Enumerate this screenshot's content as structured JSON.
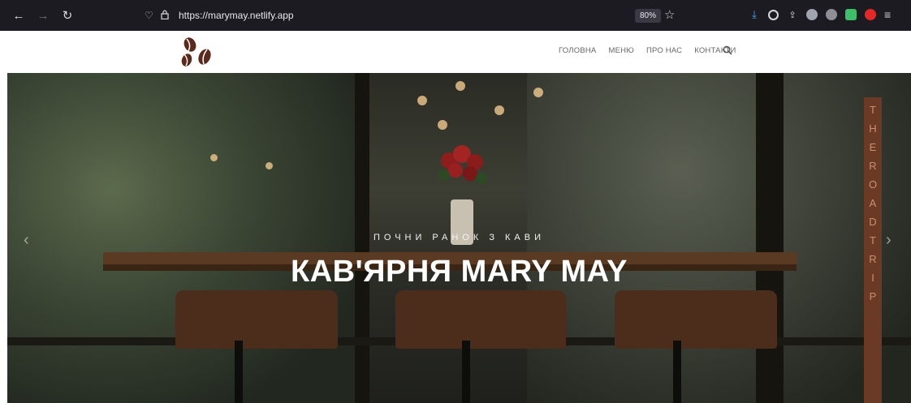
{
  "browser": {
    "url": "https://marymay.netlify.app",
    "zoom": "80%"
  },
  "nav": {
    "items": [
      "ГОЛОВНА",
      "МЕНЮ",
      "ПРО НАС",
      "КОНТАКТИ"
    ]
  },
  "hero": {
    "subtitle": "ПОЧНИ РАНОК З КАВИ",
    "title": "КАВ'ЯРНЯ MARY MAY",
    "sign_letters": [
      "T",
      "H",
      "E",
      "R",
      "O",
      "A",
      "D",
      "T",
      "R",
      "I",
      "P"
    ]
  },
  "colors": {
    "chrome_bg": "#1c1b22",
    "logo_brown": "#5a2a1c",
    "hero_text": "#ffffff"
  }
}
